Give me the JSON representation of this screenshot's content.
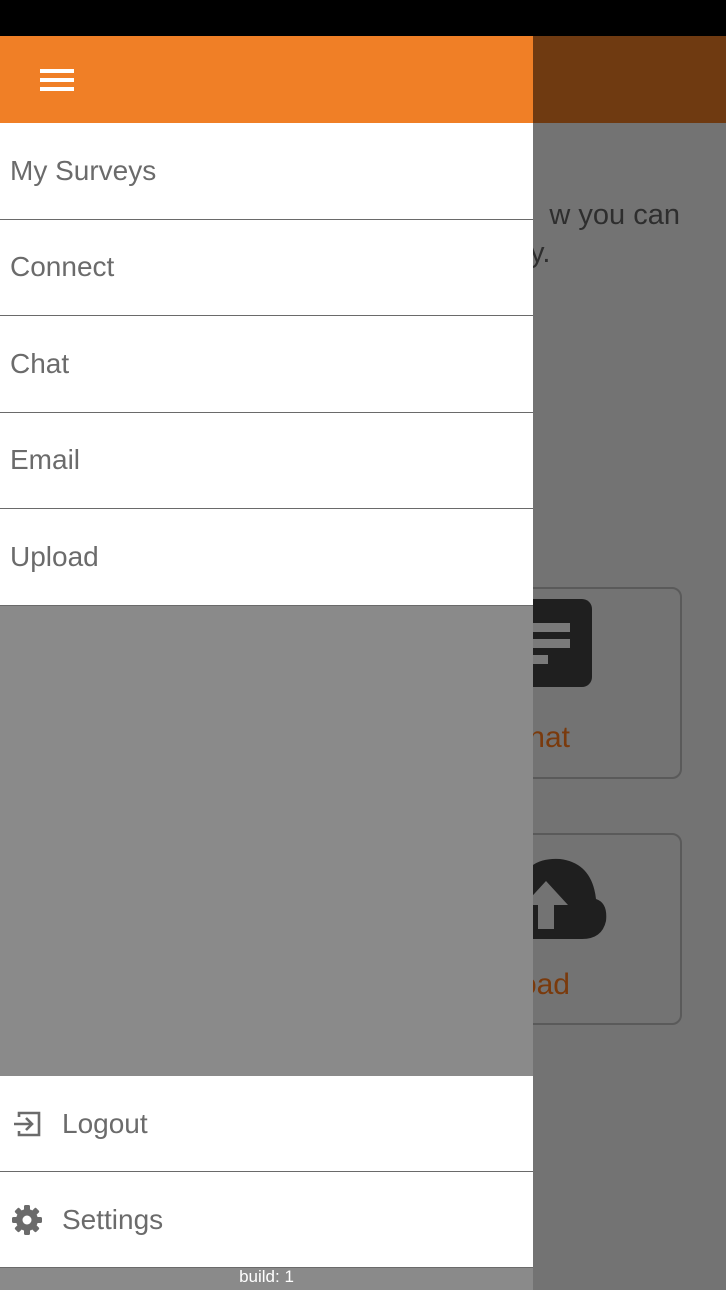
{
  "background": {
    "intro_line1": "w you can",
    "intro_line2": "y.",
    "tiles": [
      {
        "label": "hat",
        "icon": "chat-icon"
      },
      {
        "label": "oad",
        "icon": "upload-cloud-icon"
      }
    ]
  },
  "drawer": {
    "menu_icon": "hamburger-menu-icon",
    "nav_items": [
      {
        "label": "My Surveys"
      },
      {
        "label": "Connect"
      },
      {
        "label": "Chat"
      },
      {
        "label": "Email"
      },
      {
        "label": "Upload"
      }
    ],
    "bottom_items": [
      {
        "label": "Logout",
        "icon": "logout-icon"
      },
      {
        "label": "Settings",
        "icon": "gear-icon"
      }
    ],
    "build": "build: 1"
  },
  "colors": {
    "accent": "#f07f26",
    "accent_dimmed": "#6f3a11",
    "overlay": "#737373",
    "drawer_empty": "#8a8a8a",
    "text": "#6b6b6b"
  }
}
